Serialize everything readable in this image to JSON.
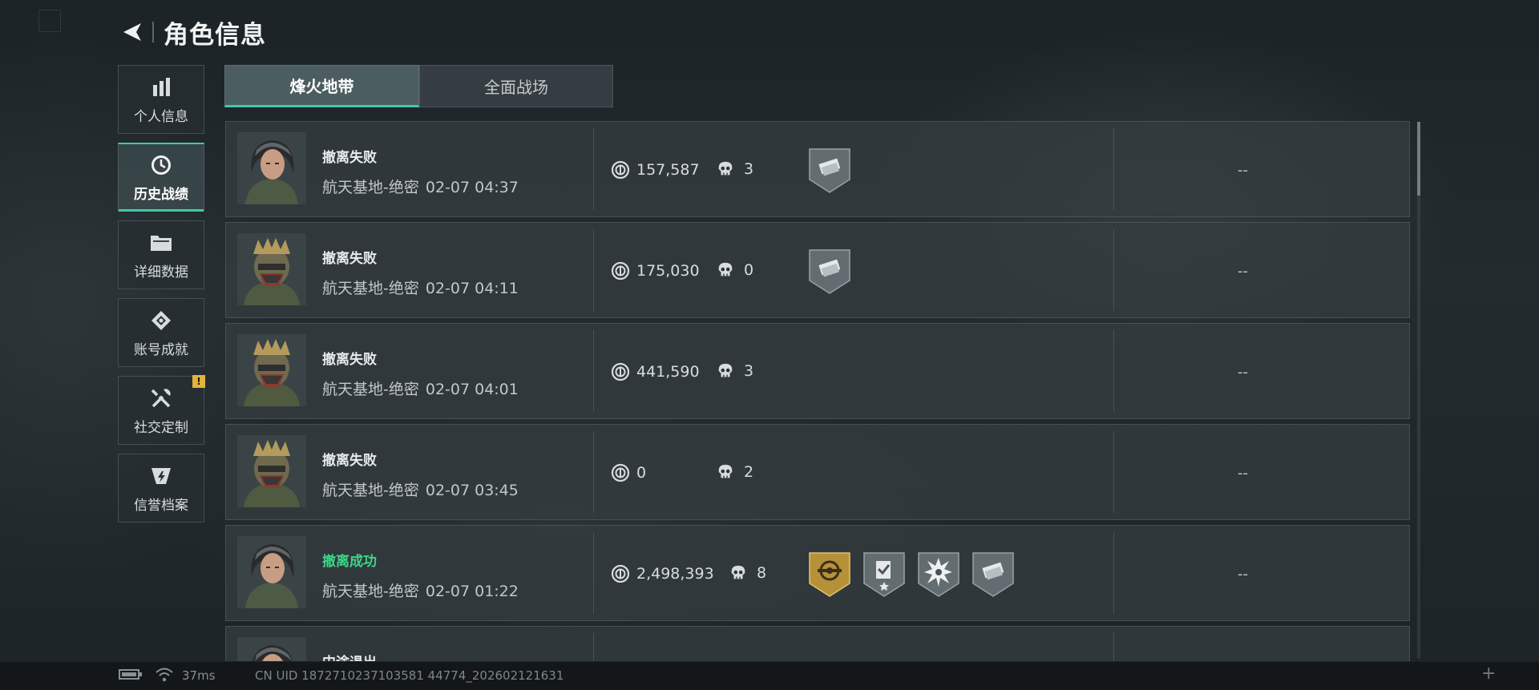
{
  "header": {
    "title": "角色信息"
  },
  "sidebar": {
    "items": [
      {
        "label": "个人信息",
        "icon": "bar-chart-icon"
      },
      {
        "label": "历史战绩",
        "icon": "clock-icon",
        "active": true
      },
      {
        "label": "详细数据",
        "icon": "folder-icon"
      },
      {
        "label": "账号成就",
        "icon": "achievement-icon"
      },
      {
        "label": "社交定制",
        "icon": "tools-icon",
        "badge": "!"
      },
      {
        "label": "信誉档案",
        "icon": "credit-shield-icon"
      }
    ]
  },
  "tabs": [
    {
      "label": "烽火地带",
      "active": true
    },
    {
      "label": "全面战场",
      "active": false
    }
  ],
  "records": [
    {
      "status": "撤离失败",
      "map": "航天基地-绝密",
      "time": "02-07 04:37",
      "coins": "157,587",
      "kills": "3",
      "operator": "female-operator",
      "badges": [
        "cash-badge"
      ],
      "extra": "--"
    },
    {
      "status": "撤离失败",
      "map": "航天基地-绝密",
      "time": "02-07 04:11",
      "coins": "175,030",
      "kills": "0",
      "operator": "armored-operator",
      "badges": [
        "cash-badge"
      ],
      "extra": "--"
    },
    {
      "status": "撤离失败",
      "map": "航天基地-绝密",
      "time": "02-07 04:01",
      "coins": "441,590",
      "kills": "3",
      "operator": "armored-operator",
      "badges": [],
      "extra": "--"
    },
    {
      "status": "撤离失败",
      "map": "航天基地-绝密",
      "time": "02-07 03:45",
      "coins": "0",
      "kills": "2",
      "operator": "armored-operator",
      "badges": [],
      "extra": "--"
    },
    {
      "status": "撤离成功",
      "map": "航天基地-绝密",
      "time": "02-07 01:22",
      "coins": "2,498,393",
      "kills": "8",
      "operator": "female-operator",
      "badges": [
        "gold-medal-badge",
        "task-badge",
        "burst-badge",
        "cash-badge"
      ],
      "extra": "--"
    },
    {
      "status": "中途退出",
      "map": "",
      "time": "",
      "coins": "",
      "kills": "",
      "operator": "female-operator",
      "badges": [],
      "extra": ""
    }
  ],
  "statusbar": {
    "ping": "37ms",
    "uid": "CN UID 1872710237103581 44774_202602121631"
  },
  "colors": {
    "accent": "#3fc9a8",
    "success": "#3fd58a",
    "badge_gold": "#c9a23c",
    "warning": "#e1b43a"
  }
}
